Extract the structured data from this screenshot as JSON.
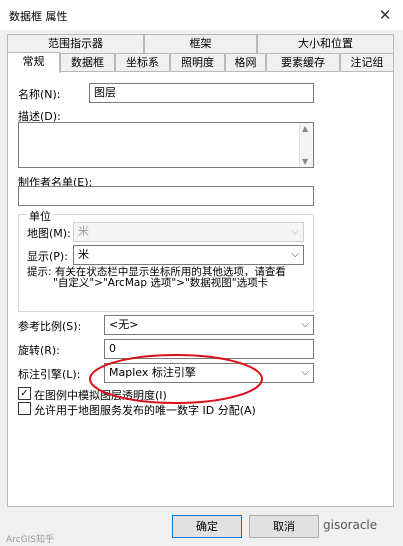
{
  "window": {
    "title": "数据框 属性",
    "close_glyph": "✕"
  },
  "tabs_row_top": [
    "范围指示器",
    "框架",
    "大小和位置"
  ],
  "tabs_row_bottom": [
    "常规",
    "数据框",
    "坐标系",
    "照明度",
    "格网",
    "要素缓存",
    "注记组"
  ],
  "active_tab": "常规",
  "form": {
    "name_label": "名称(N):",
    "name_value": "图层",
    "description_label": "描述(D):",
    "credits_label": "制作者名单(E):",
    "units_group_title": "单位",
    "map_units_label": "地图(M):",
    "map_units_value": "米",
    "display_units_label": "显示(P):",
    "display_units_value": "米",
    "hint_line1": "提示: 有关在状态栏中显示坐标所用的其他选项，请查看",
    "hint_line2": "\"自定义\">\"ArcMap 选项\">\"数据视图\"选项卡",
    "reference_scale_label": "参考比例(S):",
    "reference_scale_value": "<无>",
    "rotation_label": "旋转(R):",
    "rotation_value": "0",
    "label_engine_label": "标注引擎(L):",
    "label_engine_value": "Maplex 标注引擎",
    "simulate_transparency_label": "在图例中模拟图层透明度(I)",
    "simulate_transparency_checked": "✓",
    "allow_unique_id_label": "允许用于地图服务发布的唯一数字 ID 分配(A)"
  },
  "buttons": {
    "ok": "确定",
    "cancel": "取消"
  },
  "watermark": {
    "left": "ArcGIS知乎",
    "right": "gisoracle"
  },
  "colors": {
    "annotation_ellipse": "#d9101a",
    "primary_border": "#0078d7"
  }
}
